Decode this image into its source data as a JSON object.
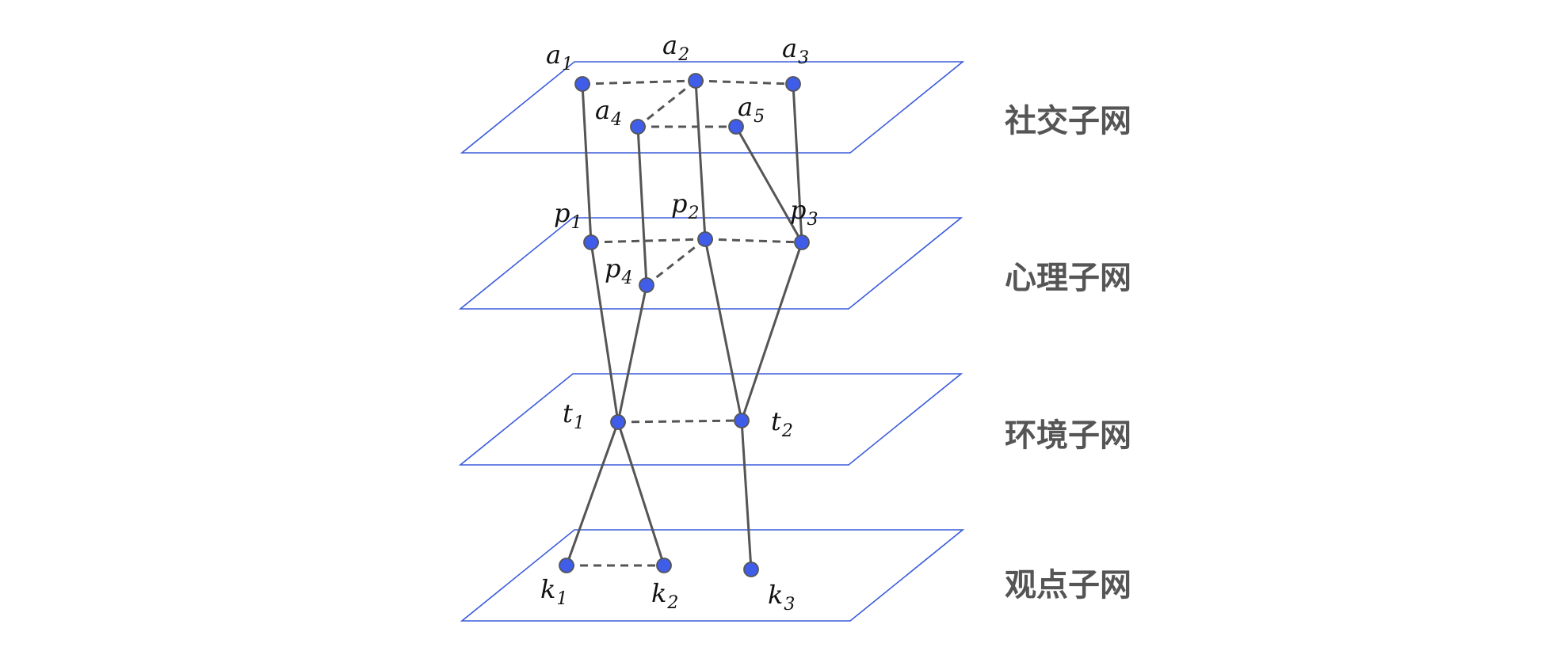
{
  "layers": [
    {
      "id": "social",
      "label": "社交子网"
    },
    {
      "id": "psych",
      "label": "心理子网"
    },
    {
      "id": "env",
      "label": "环境子网"
    },
    {
      "id": "opinion",
      "label": "观点子网"
    }
  ],
  "nodes": [
    {
      "id": "a1",
      "letter": "a",
      "sub": "1"
    },
    {
      "id": "a2",
      "letter": "a",
      "sub": "2"
    },
    {
      "id": "a3",
      "letter": "a",
      "sub": "3"
    },
    {
      "id": "a4",
      "letter": "a",
      "sub": "4"
    },
    {
      "id": "a5",
      "letter": "a",
      "sub": "5"
    },
    {
      "id": "p1",
      "letter": "p",
      "sub": "1"
    },
    {
      "id": "p2",
      "letter": "p",
      "sub": "2"
    },
    {
      "id": "p3",
      "letter": "p",
      "sub": "3"
    },
    {
      "id": "p4",
      "letter": "p",
      "sub": "4"
    },
    {
      "id": "t1",
      "letter": "t",
      "sub": "1"
    },
    {
      "id": "t2",
      "letter": "t",
      "sub": "2"
    },
    {
      "id": "k1",
      "letter": "k",
      "sub": "1"
    },
    {
      "id": "k2",
      "letter": "k",
      "sub": "2"
    },
    {
      "id": "k3",
      "letter": "k",
      "sub": "3"
    }
  ],
  "edges": {
    "intra_layer_dashed": [
      [
        "a1",
        "a2"
      ],
      [
        "a2",
        "a3"
      ],
      [
        "a2",
        "a4"
      ],
      [
        "a4",
        "a5"
      ],
      [
        "p1",
        "p2"
      ],
      [
        "p2",
        "p3"
      ],
      [
        "p2",
        "p4"
      ],
      [
        "t1",
        "t2"
      ],
      [
        "k1",
        "k2"
      ]
    ],
    "inter_layer_solid": [
      [
        "a1",
        "p1"
      ],
      [
        "a2",
        "p2"
      ],
      [
        "a3",
        "p3"
      ],
      [
        "a4",
        "p4"
      ],
      [
        "a5",
        "p3"
      ],
      [
        "p1",
        "t1"
      ],
      [
        "p4",
        "t1"
      ],
      [
        "p2",
        "t2"
      ],
      [
        "p3",
        "t2"
      ],
      [
        "t1",
        "k1"
      ],
      [
        "t1",
        "k2"
      ],
      [
        "t2",
        "k3"
      ]
    ]
  },
  "colors": {
    "plane": "#3b5bdb",
    "node_fill": "#3f5de8",
    "edge": "#555555",
    "layer_label": "#555555"
  }
}
